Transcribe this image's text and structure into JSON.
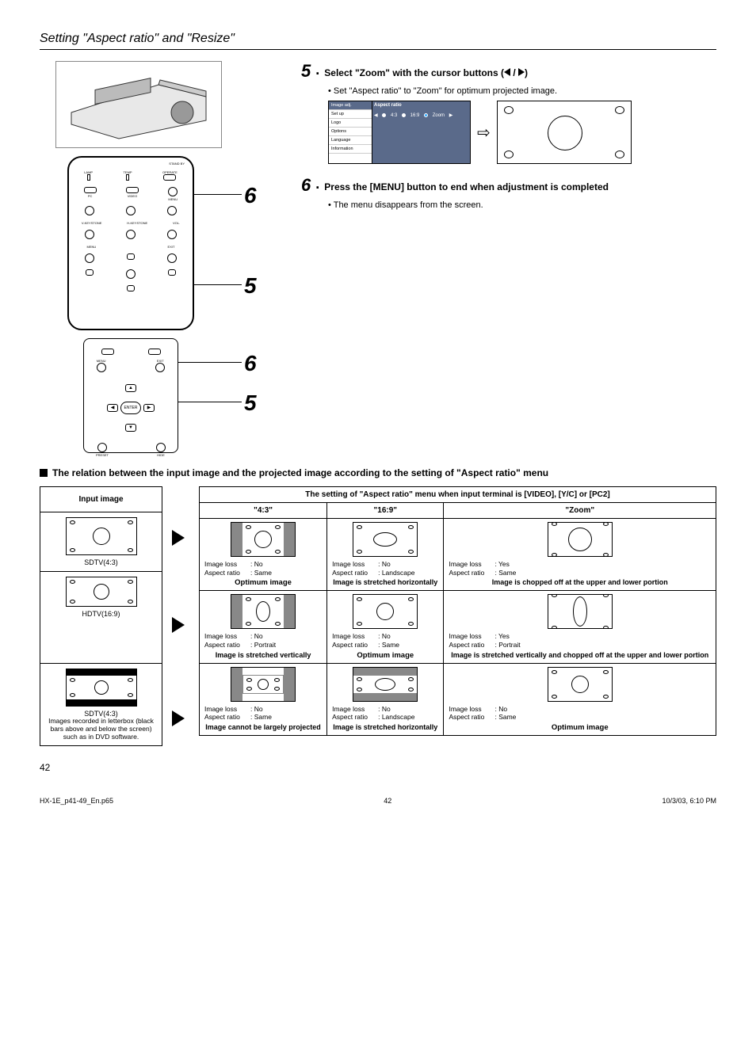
{
  "section_title": "Setting \"Aspect ratio\" and \"Resize\"",
  "callouts": {
    "a": "5",
    "b": "6"
  },
  "step5": {
    "num": "5",
    "title_prefix": "Select \"Zoom\" with the cursor buttons  (",
    "title_suffix": ")",
    "bullet": "Set \"Aspect ratio\" to \"Zoom\" for optimum projected image."
  },
  "menu": {
    "items": [
      "Image adj.",
      "Set up",
      "Logo",
      "Options",
      "Language",
      "Information"
    ],
    "header": "Aspect ratio",
    "opt1": "4:3",
    "opt2": "16:9",
    "opt3": "Zoom"
  },
  "step6": {
    "num": "6",
    "title": "Press the [MENU] button to end when adjustment is completed",
    "bullet": "The menu disappears from the screen."
  },
  "relation_heading": "The relation between the input image and the projected image according to the setting of \"Aspect ratio\" menu",
  "input_header": "Input image",
  "table_header_top": "The setting of \"Aspect ratio\" menu when input terminal is [VIDEO], [Y/C] or [PC2]",
  "col1": "\"4:3\"",
  "col2": "\"16:9\"",
  "col3": "\"Zoom\"",
  "inputs": {
    "r1": "SDTV(4:3)",
    "r2": "HDTV(16:9)",
    "r3a": "SDTV(4:3)",
    "r3b": "Images recorded in letterbox (black bars above and below the screen) such as in DVD software."
  },
  "labels": {
    "image_loss": "Image loss",
    "aspect_ratio": "Aspect ratio",
    "no": "No",
    "yes": "Yes",
    "same": "Same",
    "landscape": "Landscape",
    "portrait": "Portrait"
  },
  "results": {
    "optimum": "Optimum image",
    "stretch_h": "Image is stretched horizontally",
    "chop_ul": "Image is chopped off at the upper and lower portion",
    "stretch_v": "Image is stretched vertically",
    "stretch_v_chop": "Image is stretched vertically and chopped off at the upper and lower portion",
    "cannot": "Image cannot be largely projected"
  },
  "remote": {
    "standby": "STAND BY",
    "operate": "OPERATE",
    "lamp": "LAMP",
    "temp": "TEMP",
    "pc": "PC",
    "video": "VIDEO",
    "vkey": "V-KEYSTONE",
    "hkey": "H-KEYSTONE",
    "vol": "VOL.",
    "menu": "MENU",
    "exit": "EXIT",
    "enter": "ENTER",
    "preset": "PRESET",
    "hide": "HIDE"
  },
  "page_number": "42",
  "footer_left": "HX-1E_p41-49_En.p65",
  "footer_mid": "42",
  "footer_right": "10/3/03, 6:10 PM"
}
